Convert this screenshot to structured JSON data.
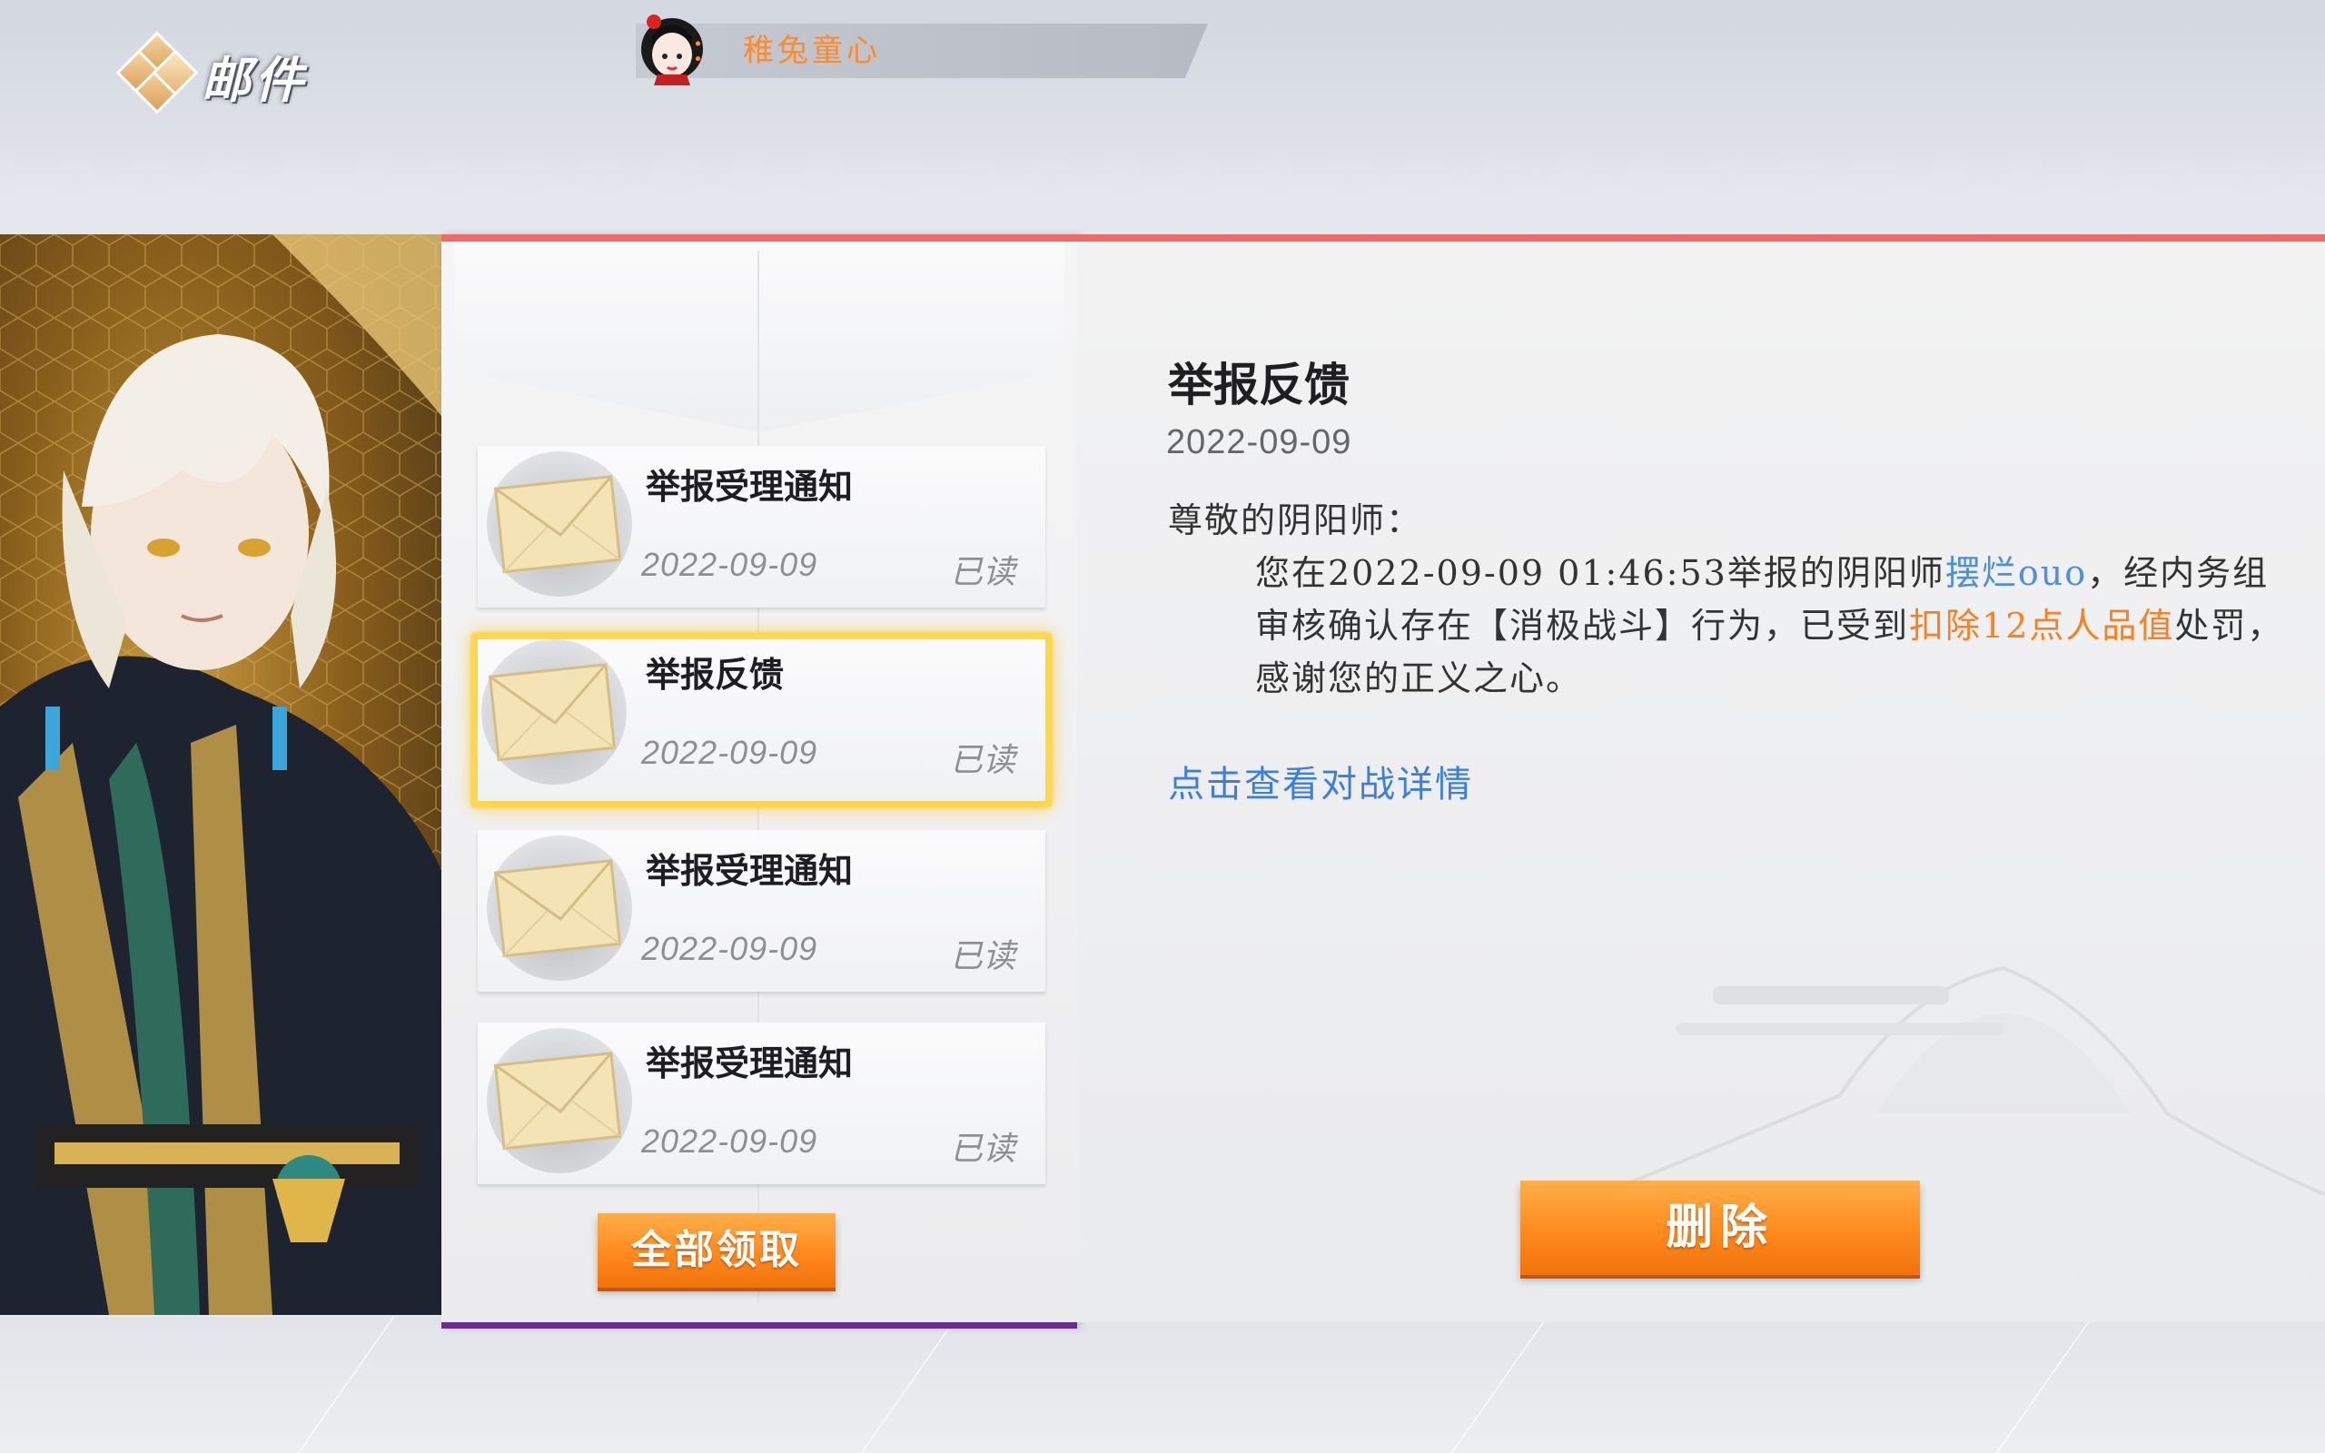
{
  "header": {
    "title": "邮件"
  },
  "player": {
    "label": "：",
    "name": "稚兔童心"
  },
  "mail_list": {
    "items": [
      {
        "title": "举报受理通知",
        "date": "2022-09-09",
        "status": "已读"
      },
      {
        "title": "举报反馈",
        "date": "2022-09-09",
        "status": "已读",
        "selected": true
      },
      {
        "title": "举报受理通知",
        "date": "2022-09-09",
        "status": "已读"
      },
      {
        "title": "举报受理通知",
        "date": "2022-09-09",
        "status": "已读"
      }
    ],
    "collect_all_label": "全部领取"
  },
  "detail": {
    "title": "举报反馈",
    "date": "2022-09-09",
    "greeting": "尊敬的阴阳师：",
    "body_part1": "您在2022-09-09 01:46:53举报的阴阳师",
    "reported_player": "摆烂ouo",
    "body_part2": "，经内务组审核确认存在【消极战斗】行为，已受到",
    "penalty": "扣除12点人品值",
    "body_part3": "处罚，感谢您的正义之心。",
    "link_text": "点击查看对战详情",
    "delete_label": "删除"
  },
  "colors": {
    "accent_orange": "#ff8a1c",
    "link_blue": "#3a7fe0",
    "panel_top_border": "#f06a6a",
    "selected_border": "#ffd84a"
  }
}
